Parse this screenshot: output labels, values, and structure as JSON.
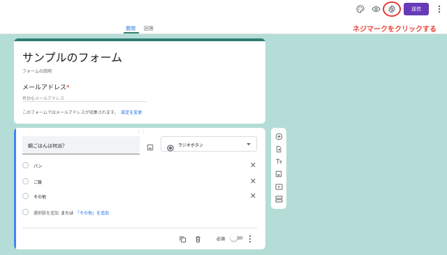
{
  "header": {
    "send_label": "送信",
    "tabs": [
      {
        "label": "質問",
        "active": true
      },
      {
        "label": "回答",
        "active": false
      }
    ],
    "icons": [
      "palette-icon",
      "preview-eye-icon",
      "settings-gear-icon",
      "more-vert-icon"
    ]
  },
  "annotation": {
    "text": "ネジマークをクリックする",
    "color": "#e8453c"
  },
  "form": {
    "title": "サンプルのフォーム",
    "description": "フォームの説明",
    "email_label": "メールアドレス",
    "required_mark": "*",
    "email_placeholder": "有効なメールアドレス",
    "collect_note": "このフォームではメールアドレスが収集されます。",
    "settings_link": "設定を変更"
  },
  "question": {
    "text": "朝ごはんは何派？",
    "type": "ラジオボタン",
    "options": [
      {
        "label": "パン"
      },
      {
        "label": "ご飯"
      },
      {
        "label": "その他"
      }
    ],
    "add_option": "選択肢を追加",
    "or_text": "または",
    "add_other": "「その他」を追加",
    "required_label": "必須",
    "required": false
  },
  "colors": {
    "background": "#b4ddd7",
    "theme_accent": "#2d7d71",
    "send_button": "#673ab7",
    "question_accent": "#4285f4",
    "link": "#1a73e8"
  }
}
